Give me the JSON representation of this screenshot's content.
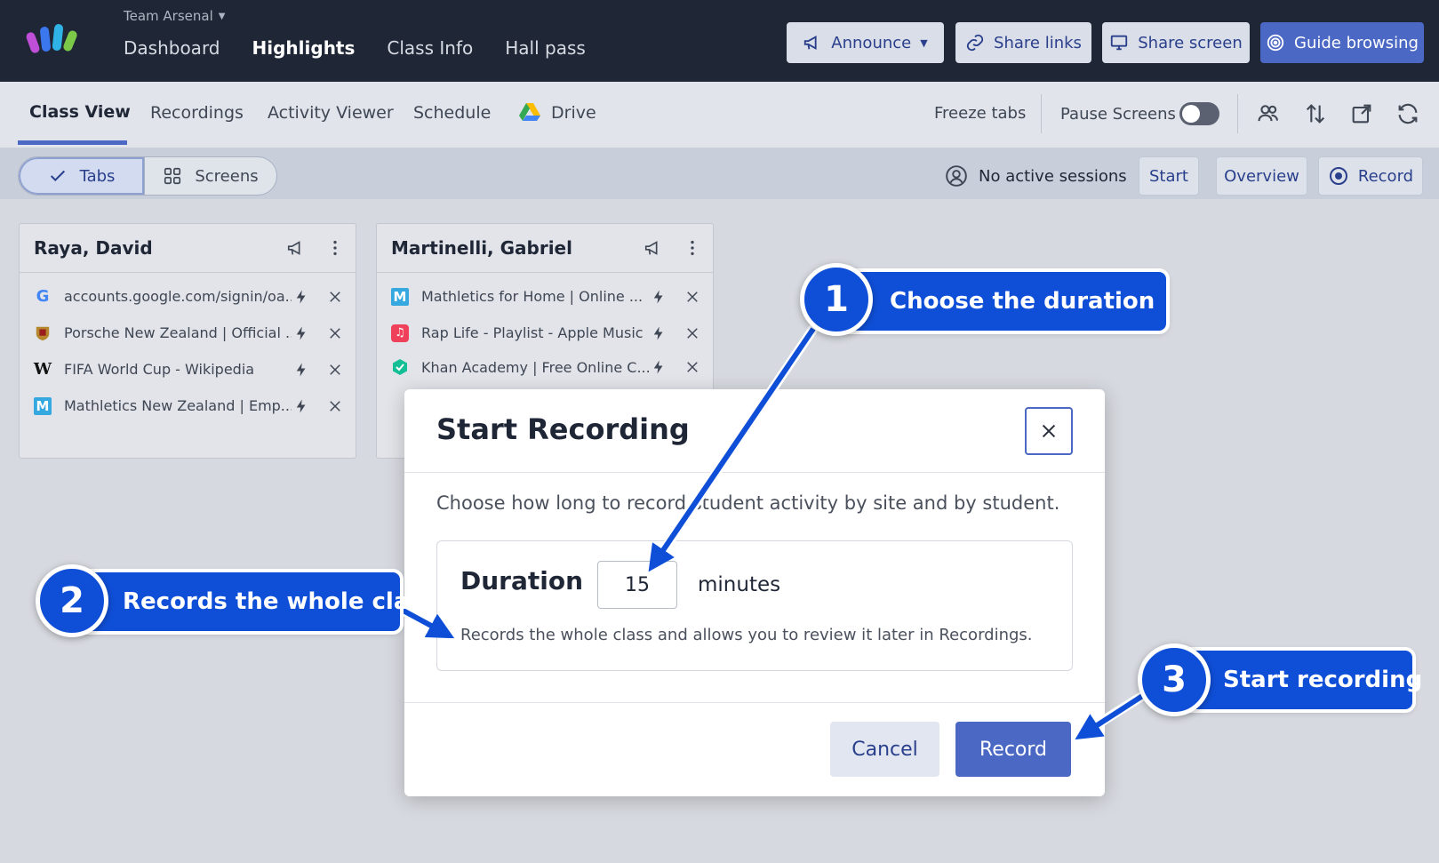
{
  "topnav": {
    "team": "Team Arsenal",
    "links": [
      "Dashboard",
      "Highlights",
      "Class Info",
      "Hall pass"
    ],
    "buttons": {
      "announce": "Announce",
      "share_links": "Share links",
      "share_screen": "Share screen",
      "guide_browsing": "Guide browsing"
    }
  },
  "subnav": {
    "tabs": [
      "Class View",
      "Recordings",
      "Activity Viewer",
      "Schedule",
      "Drive"
    ],
    "freeze_tabs": "Freeze tabs",
    "pause_screens": "Pause Screens"
  },
  "toolbar": {
    "tabs": "Tabs",
    "screens": "Screens",
    "no_sessions": "No active sessions",
    "start": "Start",
    "overview": "Overview",
    "record": "Record"
  },
  "cards": [
    {
      "name": "Raya, David",
      "rows": [
        {
          "title": "accounts.google.com/signin/oa...",
          "icon": "google-icon"
        },
        {
          "title": "Porsche New Zealand | Official ...",
          "icon": "porsche-icon"
        },
        {
          "title": "FIFA World Cup - Wikipedia",
          "icon": "wikipedia-icon"
        },
        {
          "title": "Mathletics New Zealand | Emp...",
          "icon": "mathletics-icon"
        }
      ]
    },
    {
      "name": "Martinelli, Gabriel",
      "rows": [
        {
          "title": "Mathletics for Home | Online ...",
          "icon": "mathletics-icon"
        },
        {
          "title": "Rap Life - Playlist - Apple Music",
          "icon": "apple-music-icon"
        },
        {
          "title": "Khan Academy | Free Online C...",
          "icon": "khan-academy-icon"
        }
      ]
    }
  ],
  "modal": {
    "title": "Start Recording",
    "description": "Choose how long to record student activity by site and by student.",
    "duration_label": "Duration",
    "duration_value": "15",
    "unit": "minutes",
    "help": "Records the whole class and allows you to review it later in Recordings.",
    "cancel": "Cancel",
    "record": "Record"
  },
  "callouts": [
    {
      "num": "1",
      "text": "Choose the duration"
    },
    {
      "num": "2",
      "text": "Records the whole class"
    },
    {
      "num": "3",
      "text": "Start recording"
    }
  ],
  "colors": {
    "nav_bg": "#1f2636",
    "accent": "#4a68c4",
    "callout": "#0f4fd8"
  }
}
